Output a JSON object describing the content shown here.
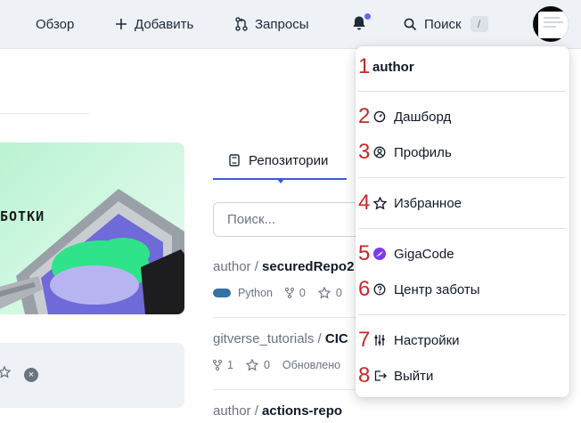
{
  "topbar": {
    "overview_label": "Обзор",
    "add_label": "Добавить",
    "requests_label": "Запросы",
    "search_label": "Поиск",
    "search_shortcut": "/"
  },
  "banner": {
    "text": "БОТКИ"
  },
  "tabs": {
    "repositories_label": "Репозитории"
  },
  "search": {
    "placeholder": "Поиск..."
  },
  "repos": [
    {
      "owner": "author / ",
      "name": "securedRepo2",
      "language": "Python",
      "forks": "0",
      "stars": "0"
    },
    {
      "owner": "gitverse_tutorials / ",
      "name": "CIC",
      "forks": "1",
      "stars": "0",
      "updated": "Обновлено"
    },
    {
      "owner": "author / ",
      "name": "actions-repo"
    }
  ],
  "dropdown": {
    "username": "author",
    "items": [
      {
        "label": "Дашборд",
        "number": "2",
        "icon": "dashboard-icon"
      },
      {
        "label": "Профиль",
        "number": "3",
        "icon": "user-circle-icon"
      },
      {
        "label": "Избранное",
        "number": "4",
        "icon": "star-icon"
      },
      {
        "label": "GigaCode",
        "number": "5",
        "icon": "gigacode-icon"
      },
      {
        "label": "Центр заботы",
        "number": "6",
        "icon": "help-icon"
      },
      {
        "label": "Настройки",
        "number": "7",
        "icon": "settings-icon"
      },
      {
        "label": "Выйти",
        "number": "8",
        "icon": "logout-icon"
      }
    ],
    "user_number": "1"
  },
  "colors": {
    "accent": "#3b5bdb",
    "annotation": "#c62828",
    "notification_dot": "#6366f1",
    "python": "#3572A5",
    "banner_green": "#2ee38a"
  }
}
